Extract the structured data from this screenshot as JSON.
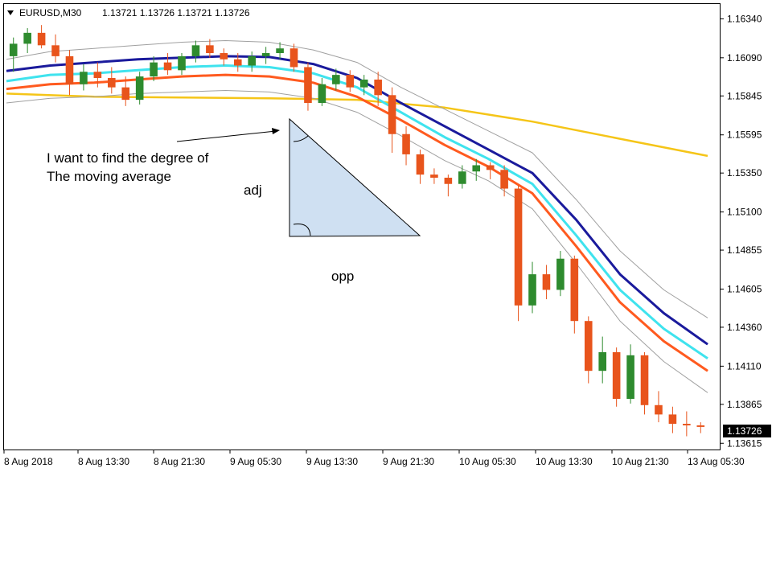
{
  "chart_data": {
    "type": "candlestick",
    "title": "EURUSD,M30  1.13721 1.13726 1.13721 1.13726",
    "symbol_timeframe": "EURUSD,M30",
    "ohlc_header": "1.13721 1.13726 1.13721 1.13726",
    "ylim": [
      1.13575,
      1.16435
    ],
    "y_ticks": [
      "1.16340",
      "1.16090",
      "1.15845",
      "1.15595",
      "1.15350",
      "1.15100",
      "1.14855",
      "1.14605",
      "1.14360",
      "1.14110",
      "1.13865",
      "1.13615"
    ],
    "y_tick_values": [
      1.1634,
      1.1609,
      1.15845,
      1.15595,
      1.1535,
      1.151,
      1.14855,
      1.14605,
      1.1436,
      1.1411,
      1.13865,
      1.13615
    ],
    "last_price": "1.13726",
    "last_price_value": 1.13726,
    "x_ticks": [
      "8 Aug 2018",
      "8 Aug 13:30",
      "8 Aug 21:30",
      "9 Aug 05:30",
      "9 Aug 13:30",
      "9 Aug 21:30",
      "10 Aug 05:30",
      "10 Aug 13:30",
      "10 Aug 21:30",
      "13 Aug 05:30"
    ],
    "grid": false,
    "colors": {
      "bull_candle": "#2e8b2e",
      "bear_candle": "#e8541c",
      "ma_yellow": "#f5c518",
      "ma_navy": "#1a1a9c",
      "ma_cyan": "#3fe3ee",
      "ma_orange": "#ff5a1f",
      "envelope": "#a0a0a0",
      "triangle_fill": "#cfe0f2"
    },
    "series": [
      {
        "name": "",
        "color": "#f5c518",
        "points": [
          [
            0,
            1.1586
          ],
          [
            20,
            1.1584
          ],
          [
            40,
            1.15835
          ],
          [
            60,
            1.1583
          ],
          [
            80,
            1.1582
          ],
          [
            100,
            1.1577
          ],
          [
            120,
            1.1568
          ],
          [
            140,
            1.1557
          ],
          [
            160,
            1.1546
          ]
        ]
      },
      {
        "name": "",
        "color": "#1a1a9c",
        "points": [
          [
            0,
            1.16005
          ],
          [
            10,
            1.1604
          ],
          [
            20,
            1.1606
          ],
          [
            30,
            1.1608
          ],
          [
            40,
            1.1609
          ],
          [
            50,
            1.161
          ],
          [
            60,
            1.16095
          ],
          [
            70,
            1.1605
          ],
          [
            80,
            1.1596
          ],
          [
            90,
            1.158
          ],
          [
            100,
            1.1565
          ],
          [
            110,
            1.155
          ],
          [
            120,
            1.1535
          ],
          [
            130,
            1.1505
          ],
          [
            140,
            1.147
          ],
          [
            150,
            1.1445
          ],
          [
            160,
            1.1425
          ]
        ]
      },
      {
        "name": "",
        "color": "#3fe3ee",
        "points": [
          [
            0,
            1.1594
          ],
          [
            10,
            1.1598
          ],
          [
            20,
            1.1599
          ],
          [
            30,
            1.1601
          ],
          [
            40,
            1.1603
          ],
          [
            50,
            1.1604
          ],
          [
            60,
            1.1603
          ],
          [
            70,
            1.1599
          ],
          [
            80,
            1.159
          ],
          [
            90,
            1.1574
          ],
          [
            100,
            1.1558
          ],
          [
            110,
            1.1544
          ],
          [
            120,
            1.1528
          ],
          [
            130,
            1.1495
          ],
          [
            140,
            1.146
          ],
          [
            150,
            1.1435
          ],
          [
            160,
            1.1416
          ]
        ]
      },
      {
        "name": "",
        "color": "#ff5a1f",
        "points": [
          [
            0,
            1.1589
          ],
          [
            10,
            1.1592
          ],
          [
            20,
            1.1593
          ],
          [
            30,
            1.1595
          ],
          [
            40,
            1.1597
          ],
          [
            50,
            1.1598
          ],
          [
            60,
            1.1597
          ],
          [
            70,
            1.1593
          ],
          [
            80,
            1.1584
          ],
          [
            90,
            1.1569
          ],
          [
            100,
            1.1553
          ],
          [
            110,
            1.1539
          ],
          [
            120,
            1.1522
          ],
          [
            130,
            1.1488
          ],
          [
            140,
            1.1452
          ],
          [
            150,
            1.1427
          ],
          [
            160,
            1.1408
          ]
        ]
      },
      {
        "name": "",
        "color": "#a0a0a0",
        "points": [
          [
            0,
            1.1608
          ],
          [
            10,
            1.1613
          ],
          [
            20,
            1.1615
          ],
          [
            30,
            1.1617
          ],
          [
            40,
            1.1619
          ],
          [
            50,
            1.162
          ],
          [
            60,
            1.1619
          ],
          [
            70,
            1.1614
          ],
          [
            80,
            1.1606
          ],
          [
            90,
            1.159
          ],
          [
            100,
            1.1576
          ],
          [
            110,
            1.1562
          ],
          [
            120,
            1.1548
          ],
          [
            130,
            1.1518
          ],
          [
            140,
            1.1485
          ],
          [
            150,
            1.146
          ],
          [
            160,
            1.1442
          ]
        ]
      },
      {
        "name": "",
        "color": "#a0a0a0",
        "points": [
          [
            0,
            1.158
          ],
          [
            10,
            1.1583
          ],
          [
            20,
            1.1584
          ],
          [
            30,
            1.1586
          ],
          [
            40,
            1.1587
          ],
          [
            50,
            1.1588
          ],
          [
            60,
            1.1587
          ],
          [
            70,
            1.1583
          ],
          [
            80,
            1.1574
          ],
          [
            90,
            1.1559
          ],
          [
            100,
            1.1543
          ],
          [
            110,
            1.153
          ],
          [
            120,
            1.1512
          ],
          [
            130,
            1.1477
          ],
          [
            140,
            1.144
          ],
          [
            150,
            1.1414
          ],
          [
            160,
            1.1394
          ]
        ]
      }
    ],
    "candles": [
      [
        1.161,
        1.1622,
        1.16,
        1.1618
      ],
      [
        1.1618,
        1.1628,
        1.1612,
        1.1625
      ],
      [
        1.1625,
        1.163,
        1.1615,
        1.1617
      ],
      [
        1.1617,
        1.1624,
        1.1606,
        1.161
      ],
      [
        1.161,
        1.1614,
        1.1585,
        1.1592
      ],
      [
        1.1592,
        1.1605,
        1.1588,
        1.16
      ],
      [
        1.16,
        1.1606,
        1.159,
        1.1596
      ],
      [
        1.1596,
        1.1603,
        1.1586,
        1.159
      ],
      [
        1.159,
        1.1597,
        1.1578,
        1.1582
      ],
      [
        1.1582,
        1.16,
        1.1579,
        1.1597
      ],
      [
        1.1597,
        1.161,
        1.1594,
        1.1606
      ],
      [
        1.1606,
        1.1612,
        1.1598,
        1.1601
      ],
      [
        1.1601,
        1.1612,
        1.1598,
        1.161
      ],
      [
        1.161,
        1.162,
        1.1606,
        1.1617
      ],
      [
        1.1617,
        1.1621,
        1.1609,
        1.1612
      ],
      [
        1.1612,
        1.1615,
        1.1604,
        1.1608
      ],
      [
        1.1608,
        1.1612,
        1.16,
        1.1604
      ],
      [
        1.1604,
        1.1613,
        1.16,
        1.161
      ],
      [
        1.161,
        1.1616,
        1.1605,
        1.1612
      ],
      [
        1.1612,
        1.1619,
        1.1608,
        1.1615
      ],
      [
        1.1615,
        1.1618,
        1.16,
        1.1603
      ],
      [
        1.1603,
        1.1606,
        1.1575,
        1.158
      ],
      [
        1.158,
        1.1596,
        1.1578,
        1.1592
      ],
      [
        1.1592,
        1.1602,
        1.1588,
        1.1598
      ],
      [
        1.1598,
        1.1601,
        1.1587,
        1.159
      ],
      [
        1.159,
        1.1598,
        1.1585,
        1.1595
      ],
      [
        1.1595,
        1.16,
        1.1578,
        1.1585
      ],
      [
        1.1585,
        1.159,
        1.1548,
        1.156
      ],
      [
        1.156,
        1.1565,
        1.154,
        1.1547
      ],
      [
        1.1547,
        1.155,
        1.1528,
        1.1534
      ],
      [
        1.1534,
        1.1538,
        1.1528,
        1.1532
      ],
      [
        1.1532,
        1.1534,
        1.152,
        1.1528
      ],
      [
        1.1528,
        1.154,
        1.1525,
        1.1536
      ],
      [
        1.1536,
        1.1544,
        1.153,
        1.154
      ],
      [
        1.154,
        1.1542,
        1.1531,
        1.1537
      ],
      [
        1.1537,
        1.154,
        1.152,
        1.1525
      ],
      [
        1.1525,
        1.1527,
        1.144,
        1.145
      ],
      [
        1.145,
        1.1478,
        1.1445,
        1.147
      ],
      [
        1.147,
        1.1476,
        1.1454,
        1.146
      ],
      [
        1.146,
        1.1485,
        1.1456,
        1.148
      ],
      [
        1.148,
        1.1482,
        1.1432,
        1.144
      ],
      [
        1.144,
        1.1443,
        1.14,
        1.1408
      ],
      [
        1.1408,
        1.143,
        1.14,
        1.142
      ],
      [
        1.142,
        1.1423,
        1.1385,
        1.139
      ],
      [
        1.139,
        1.1425,
        1.1387,
        1.1418
      ],
      [
        1.1418,
        1.142,
        1.138,
        1.1386
      ],
      [
        1.1386,
        1.1395,
        1.1375,
        1.138
      ],
      [
        1.138,
        1.1385,
        1.1368,
        1.1374
      ],
      [
        1.1374,
        1.1382,
        1.1366,
        1.1373
      ],
      [
        1.1373,
        1.1375,
        1.1368,
        1.1372
      ]
    ],
    "annotations": {
      "question": [
        "I want to find the degree of",
        "The moving average"
      ],
      "adj_label": "adj",
      "opp_label": "opp"
    }
  }
}
